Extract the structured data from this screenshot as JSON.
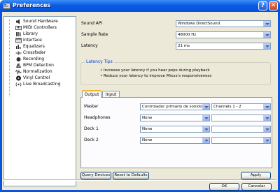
{
  "window": {
    "title": "Preferences"
  },
  "sidebar": {
    "items": [
      {
        "label": "Sound Hardware",
        "icon": "speaker-icon"
      },
      {
        "label": "MIDI Controllers",
        "icon": "keyboard-icon"
      },
      {
        "label": "Library",
        "icon": "library-icon"
      },
      {
        "label": "Interface",
        "icon": "interface-icon"
      },
      {
        "label": "Equalizers",
        "icon": "equalizer-icon"
      },
      {
        "label": "Crossfader",
        "icon": "crossfader-icon"
      },
      {
        "label": "Recording",
        "icon": "recording-icon"
      },
      {
        "label": "BPM Detection",
        "icon": "bpm-icon"
      },
      {
        "label": "Normalization",
        "icon": "normalization-icon"
      },
      {
        "label": "Vinyl Control",
        "icon": "vinyl-icon"
      },
      {
        "label": "Live Broadcasting",
        "icon": "broadcast-icon"
      }
    ]
  },
  "settings": {
    "sound_api": {
      "label": "Sound API",
      "value": "Windows DirectSound"
    },
    "sample_rate": {
      "label": "Sample Rate",
      "value": "48000 Hz"
    },
    "latency": {
      "label": "Latency",
      "value": "21 ms"
    }
  },
  "latency_tips": {
    "title": "Latency Tips",
    "tips": [
      "• Increase your latency if you hear pops during playback",
      "• Reduce your latency to improve Mixxx's responsiveness"
    ]
  },
  "tabs": [
    {
      "label": "Output"
    },
    {
      "label": "Input"
    }
  ],
  "output_rows": [
    {
      "label": "Master",
      "device": "Controlador primario de sonido",
      "channels": "Channels 1 - 2"
    },
    {
      "label": "Headphones",
      "device": "None",
      "channels": ""
    },
    {
      "label": "Deck 1",
      "device": "None",
      "channels": ""
    },
    {
      "label": "Deck 2",
      "device": "None",
      "channels": ""
    }
  ],
  "buttons": {
    "query_devices": "Query Devices",
    "reset_defaults": "Reset to Defaults",
    "apply": "Apply",
    "ok": "OK",
    "cancel": "Cancelar"
  },
  "colors": {
    "title_bar": "#0a53df",
    "group_title": "#0046d5",
    "tab_highlight": "#f7b32b"
  }
}
